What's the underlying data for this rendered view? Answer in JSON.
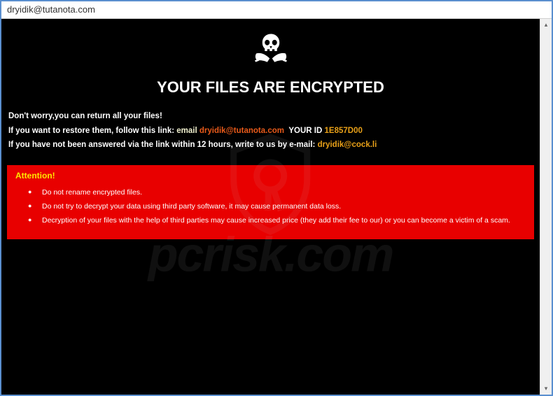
{
  "window": {
    "title": "dryidik@tutanota.com"
  },
  "header": {
    "icon_name": "skull-swords-icon",
    "title": "YOUR FILES ARE ENCRYPTED"
  },
  "info": {
    "line1": "Don't worry,you can return all your files!",
    "line2_prefix": "If you want to restore them, follow this link:",
    "line2_email_label": "email",
    "line2_email": "dryidik@tutanota.com",
    "line2_yourid_label": "YOUR ID",
    "line2_id": "1E857D00",
    "line3_prefix": "If you have not been answered via the link within 12 hours, write to us by e-mail:",
    "line3_email": "dryidik@cock.li"
  },
  "attention": {
    "title": "Attention!",
    "items": [
      "Do not rename encrypted files.",
      "Do not try to decrypt your data using third party software, it may cause permanent data loss.",
      "Decryption of your files with the help of third parties may cause increased price (they add their fee to our) or you can become a victim of a scam."
    ]
  },
  "watermark": {
    "text": "pcrisk.com"
  },
  "scrollbar": {
    "up": "▴",
    "down": "▾"
  }
}
